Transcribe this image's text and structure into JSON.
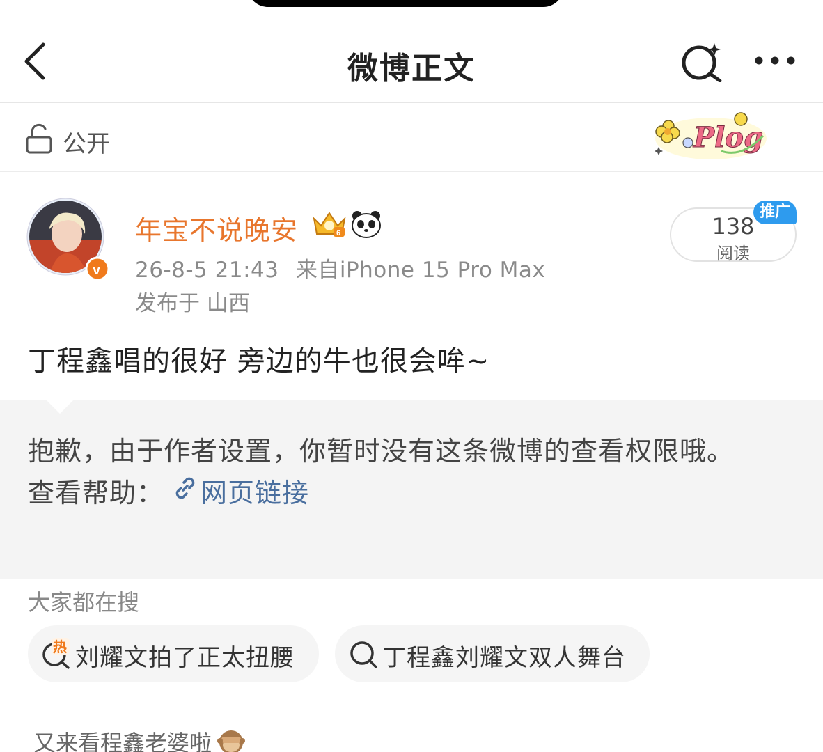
{
  "nav": {
    "title": "微博正文"
  },
  "visibility": {
    "label": "公开"
  },
  "post": {
    "username": "年宝不说晚安",
    "timestamp": "26-8-5 21:43",
    "source": "来自iPhone 15 Pro Max",
    "location": "发布于 山西",
    "reads_count": "138",
    "reads_label": "阅读",
    "promo_badge": "推广",
    "text": "丁程鑫唱的很好 旁边的牛也很会哞~",
    "sticker_text": "Plog"
  },
  "notice": {
    "message": "抱歉，由于作者设置，你暂时没有这条微博的查看权限哦。",
    "help_prefix": "查看帮助：",
    "help_link": "网页链接"
  },
  "hot_search": {
    "title": "大家都在搜",
    "items": [
      {
        "label": "刘耀文拍了正太扭腰",
        "icon": "hot-search-icon",
        "badge": "热"
      },
      {
        "label": "丁程鑫刘耀文双人舞台",
        "icon": "search-icon"
      }
    ]
  },
  "comment": {
    "text": "又来看程鑫老婆啦"
  },
  "colors": {
    "username": "#e8762d",
    "link": "#496e9e",
    "promo": "#2e9bee",
    "verified": "#f07a1c"
  }
}
